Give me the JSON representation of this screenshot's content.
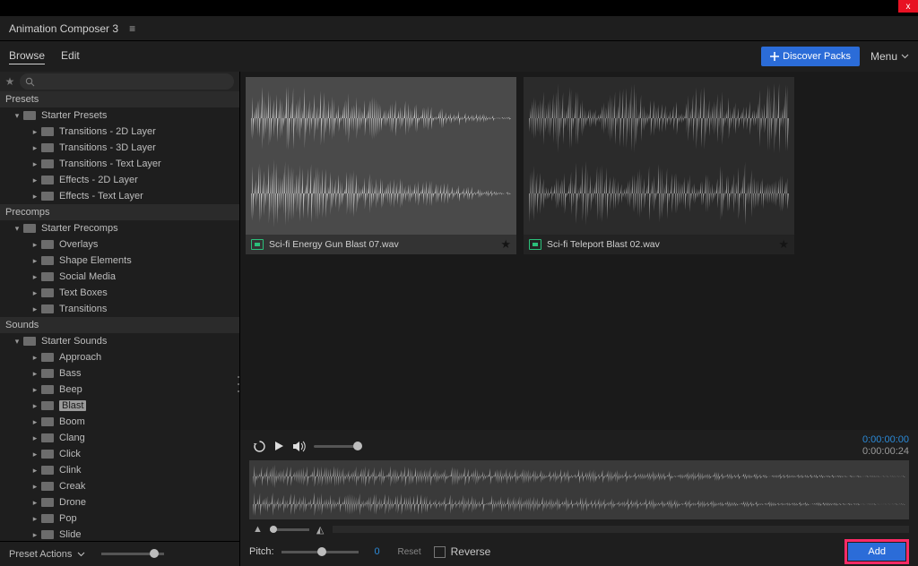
{
  "app": {
    "title": "Animation Composer 3"
  },
  "tabs": {
    "browse": "Browse",
    "edit": "Edit"
  },
  "header": {
    "discover": "Discover Packs",
    "menu": "Menu"
  },
  "sidebar": {
    "groups": [
      {
        "head": "Presets",
        "parent": "Starter Presets",
        "children": [
          "Transitions - 2D Layer",
          "Transitions - 3D Layer",
          "Transitions - Text Layer",
          "Effects - 2D Layer",
          "Effects - Text Layer"
        ]
      },
      {
        "head": "Precomps",
        "parent": "Starter Precomps",
        "children": [
          "Overlays",
          "Shape Elements",
          "Social Media",
          "Text Boxes",
          "Transitions"
        ]
      },
      {
        "head": "Sounds",
        "parent": "Starter Sounds",
        "children": [
          "Approach",
          "Bass",
          "Beep",
          "Blast",
          "Boom",
          "Clang",
          "Click",
          "Clink",
          "Creak",
          "Drone",
          "Pop",
          "Slide"
        ]
      }
    ],
    "selected_child": "Blast",
    "preset_actions": "Preset Actions"
  },
  "cards": [
    {
      "name": "Sci-fi Energy Gun Blast 07.wav",
      "selected": true
    },
    {
      "name": "Sci-fi Teleport Blast 02.wav",
      "selected": false
    }
  ],
  "preview": {
    "timecode_current": "0:00:00:00",
    "timecode_total": "0:00:00:24"
  },
  "pitch": {
    "label": "Pitch:",
    "value": "0",
    "reset": "Reset",
    "reverse": "Reverse"
  },
  "buttons": {
    "add": "Add"
  }
}
